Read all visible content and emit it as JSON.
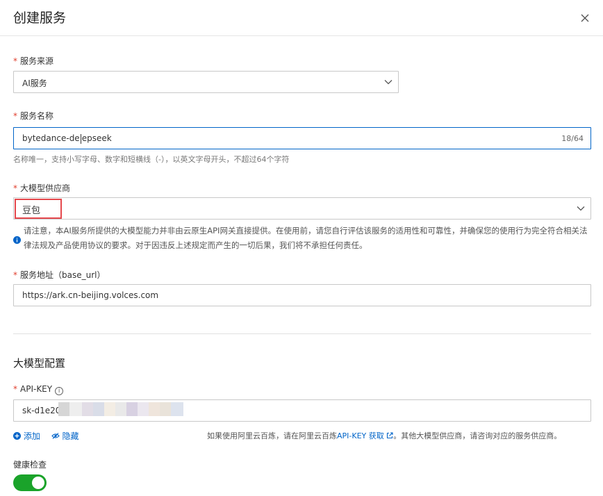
{
  "dialog": {
    "title": "创建服务"
  },
  "service_source": {
    "label": "服务来源",
    "value": "AI服务"
  },
  "service_name": {
    "label": "服务名称",
    "value_before_cursor": "bytedance-de",
    "value_after_cursor": "epseek",
    "counter": "18/64",
    "hint": "名称唯一，支持小写字母、数字和短横线（-），以英文字母开头，不超过64个字符"
  },
  "provider": {
    "label": "大模型供应商",
    "value": "豆包",
    "notice": "请注意，本AI服务所提供的大模型能力并非由云原生API网关直接提供。在使用前，请您自行评估该服务的适用性和可靠性，并确保您的使用行为完全符合相关法律法规及产品使用协议的要求。对于因违反上述规定而产生的一切后果，我们将不承担任何责任。"
  },
  "base_url": {
    "label": "服务地址（base_url）",
    "value": "https://ark.cn-beijing.volces.com"
  },
  "model_config": {
    "section_title": "大模型配置",
    "api_key_label": "API-KEY",
    "api_key_visible": "sk-d1e20",
    "add_label": "添加",
    "hide_label": "隐藏",
    "hint_prefix": "如果使用阿里云百炼，请在阿里云百炼",
    "hint_link": "API-KEY 获取",
    "hint_suffix": "。其他大模型供应商，请咨询对应的服务供应商。"
  },
  "health_check": {
    "label": "健康检查",
    "enabled": true
  },
  "colors": {
    "primary": "#0064c8",
    "required": "#e03e2d",
    "switch_on": "#1aa32a",
    "highlight": "#e5484d"
  }
}
